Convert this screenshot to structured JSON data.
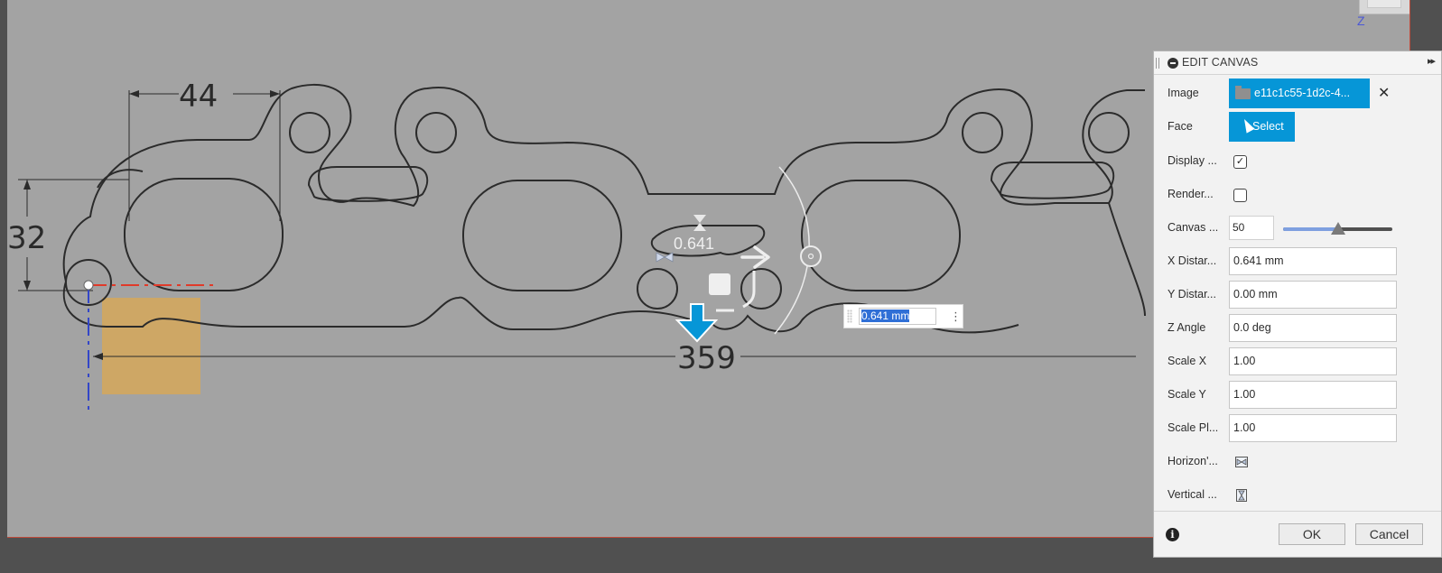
{
  "viewport": {
    "dimensions": {
      "width": "44",
      "height": "32",
      "length": "359"
    },
    "gizmo_value": "0.641",
    "inline_input": {
      "value": "0.641 mm"
    },
    "axis_label": "Z"
  },
  "panel": {
    "title": "EDIT CANVAS",
    "collapse_glyph": "▸▸",
    "rows": {
      "image": {
        "label": "Image",
        "value": "e11c1c55-1d2c-4..."
      },
      "face": {
        "label": "Face",
        "button": "Select"
      },
      "display": {
        "label": "Display ...",
        "checked": true
      },
      "render": {
        "label": "Render...",
        "checked": false
      },
      "canvas_opacity": {
        "label": "Canvas ...",
        "value": "50",
        "slider_percent": 50
      },
      "x_distance": {
        "label": "X Distar...",
        "value": "0.641 mm"
      },
      "y_distance": {
        "label": "Y Distar...",
        "value": "0.00 mm"
      },
      "z_angle": {
        "label": "Z Angle",
        "value": "0.0 deg"
      },
      "scale_x": {
        "label": "Scale X",
        "value": "1.00"
      },
      "scale_y": {
        "label": "Scale Y",
        "value": "1.00"
      },
      "scale_plane": {
        "label": "Scale Pl...",
        "value": "1.00"
      },
      "horizontal_flip": {
        "label": "Horizon'...",
        "icon": "flip-horizontal-icon"
      },
      "vertical_flip": {
        "label": "Vertical ...",
        "icon": "flip-vertical-icon"
      }
    },
    "footer": {
      "ok": "OK",
      "cancel": "Cancel"
    }
  },
  "colors": {
    "accent": "#0696d7",
    "canvas_bg": "#a3a3a3",
    "overlay_image": "#d6a85a",
    "x_axis": "#e03a2a",
    "y_axis": "#3346c8"
  }
}
